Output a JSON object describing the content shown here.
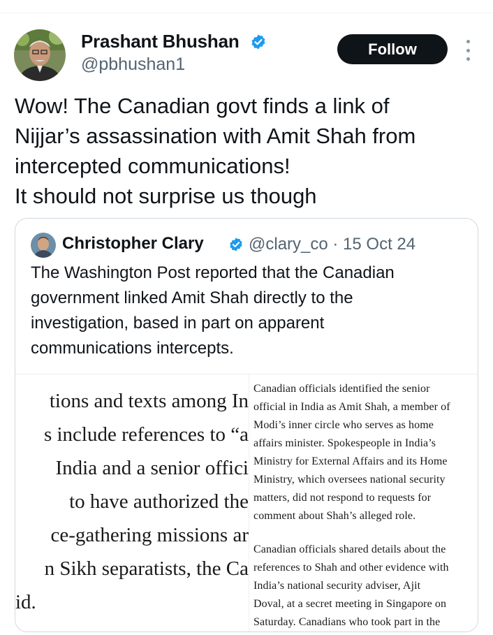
{
  "colors": {
    "text_primary": "#0f1419",
    "text_secondary": "#536471",
    "verified_blue": "#1d9bf0",
    "follow_bg": "#0f1419",
    "card_border": "#cfd9de"
  },
  "tweet": {
    "author_name": "Prashant Bhushan",
    "author_handle": "@pbhushan1",
    "follow_label": "Follow",
    "text_lines": [
      "Wow! The Canadian govt finds a link of",
      "Nijjar’s assassination with Amit Shah from",
      "intercepted communications!",
      "It should not surprise us though"
    ],
    "icons": {
      "verified": "verified-badge-icon",
      "more": "more-vertical-icon"
    }
  },
  "quote": {
    "author_name": "Christopher Clary",
    "meta": "@clary_co · 15 Oct 24",
    "text_lines": [
      "The Washington Post reported that the Canadian",
      "government linked Amit Shah directly to the",
      "investigation, based in part on apparent",
      "communications intercepts."
    ],
    "article_left_lines": [
      "tions and texts among In",
      "s include references to “a",
      "India and a senior offici",
      "to have authorized the",
      "ce-gathering missions ar",
      "n Sikh separatists, the Ca",
      "id."
    ],
    "article_right_lines": [
      "Canadian officials identified the senior",
      "official in India as Amit Shah, a member of",
      "Modi’s inner circle who serves as home",
      "affairs minister. Spokespeople in India’s",
      "Ministry for External Affairs and its Home",
      "Ministry, which oversees national security",
      "matters, did not respond to requests for",
      "comment about Shah’s alleged role.",
      "Canadian officials shared details about the",
      "references to Shah and other evidence with",
      "India’s national security adviser, Ajit",
      "Doval, at a secret meeting in Singapore on",
      "Saturday. Canadians who took part in the"
    ]
  }
}
